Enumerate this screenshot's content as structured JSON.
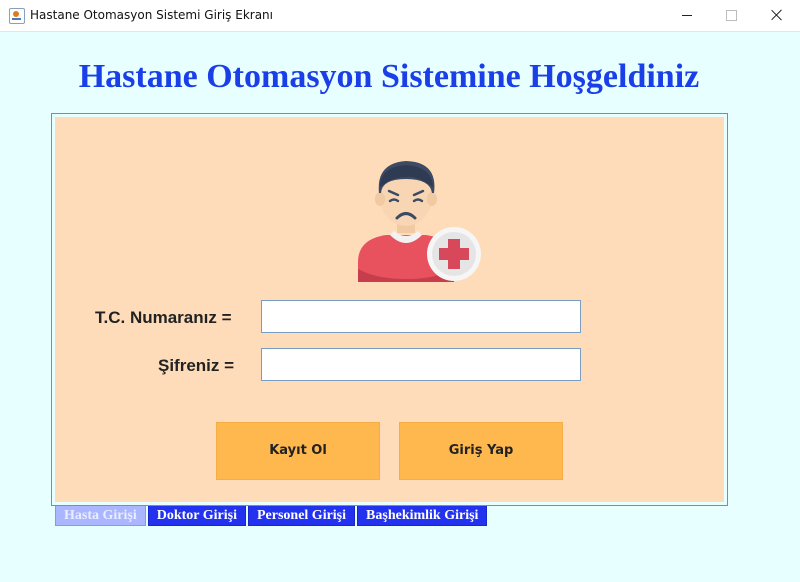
{
  "window": {
    "title": "Hastane Otomasyon Sistemi Giriş Ekranı",
    "controls": [
      "minimize-icon",
      "maximize-icon",
      "close-icon"
    ]
  },
  "heading": "Hastane Otomasyon Sistemine Hoşgeldiniz",
  "form": {
    "tc_label": "T.C. Numaranız =",
    "tc_value": "",
    "password_label": "Şifreniz =",
    "password_value": ""
  },
  "buttons": {
    "register": "Kayıt Ol",
    "login": "Giriş Yap"
  },
  "tabs": [
    {
      "label": "Hasta Girişi",
      "active": true
    },
    {
      "label": "Doktor Girişi",
      "active": false
    },
    {
      "label": "Personel Girişi",
      "active": false
    },
    {
      "label": "Başhekimlik Girişi",
      "active": false
    }
  ],
  "colors": {
    "background": "#e7ffff",
    "heading": "#1a3ee8",
    "panel": "#fedcb9",
    "button": "#ffb84d",
    "tab": "#2232ee",
    "tab_active": "#aab6ff"
  },
  "icons": {
    "avatar": "patient-avatar-icon"
  }
}
